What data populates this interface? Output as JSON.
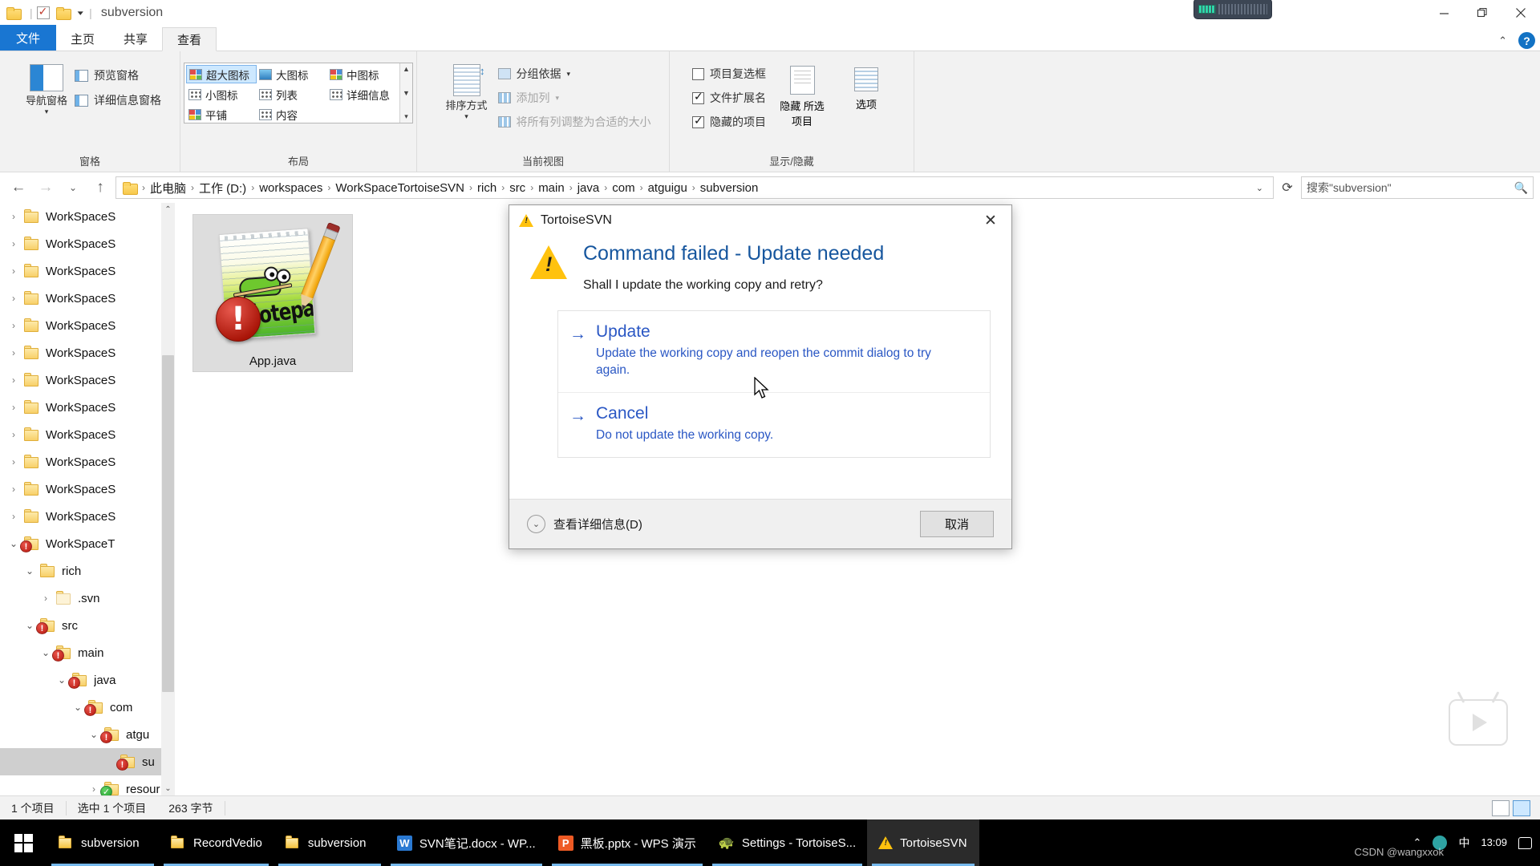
{
  "window": {
    "title": "subversion",
    "quick_access": {
      "folder_icon": "folder-icon",
      "properties_icon": "properties-checkbox-icon",
      "new_folder_icon": "new-folder-icon",
      "dropdown_icon": "chevron-down-icon"
    },
    "controls": {
      "minimize": "minimize-icon",
      "maximize": "maximize-icon",
      "close": "close-icon",
      "collapse_ribbon": "chevron-up-icon",
      "help": "?"
    }
  },
  "tabs": [
    {
      "label": "文件",
      "state": "file-menu"
    },
    {
      "label": "主页",
      "state": "normal"
    },
    {
      "label": "共享",
      "state": "normal"
    },
    {
      "label": "查看",
      "state": "active"
    }
  ],
  "ribbon": {
    "groups": [
      {
        "name": "窗格",
        "big_button": {
          "label": "导航窗格",
          "icon": "navigation-pane-icon",
          "has_dropdown": true
        },
        "items": [
          {
            "label": "预览窗格",
            "icon": "preview-pane-icon",
            "disabled": false
          },
          {
            "label": "详细信息窗格",
            "icon": "details-pane-icon",
            "disabled": false
          }
        ]
      },
      {
        "name": "布局",
        "views": [
          {
            "label": "超大图标",
            "selected": true
          },
          {
            "label": "大图标",
            "selected": false
          },
          {
            "label": "中图标",
            "selected": false
          },
          {
            "label": "小图标",
            "selected": false
          },
          {
            "label": "列表",
            "selected": false
          },
          {
            "label": "详细信息",
            "selected": false
          },
          {
            "label": "平铺",
            "selected": false
          },
          {
            "label": "内容",
            "selected": false
          }
        ]
      },
      {
        "name": "当前视图",
        "big_button": {
          "label": "排序方式",
          "icon": "sort-icon",
          "has_dropdown": true
        },
        "items": [
          {
            "label": "分组依据",
            "icon": "group-by-icon",
            "disabled": false,
            "has_dropdown": true
          },
          {
            "label": "添加列",
            "icon": "add-column-icon",
            "disabled": true,
            "has_dropdown": true
          },
          {
            "label": "将所有列调整为合适的大小",
            "icon": "fit-columns-icon",
            "disabled": true
          }
        ]
      },
      {
        "name": "显示/隐藏",
        "checkboxes": [
          {
            "label": "项目复选框",
            "checked": false
          },
          {
            "label": "文件扩展名",
            "checked": true
          },
          {
            "label": "隐藏的项目",
            "checked": true
          }
        ],
        "buttons": [
          {
            "label": "隐藏 所选项目",
            "icon": "hide-selected-icon"
          },
          {
            "label": "选项",
            "icon": "options-icon"
          }
        ]
      }
    ]
  },
  "address_bar": {
    "back_icon": "back-arrow-icon",
    "forward_icon": "forward-arrow-icon",
    "recent_icon": "chevron-down-icon",
    "up_icon": "up-arrow-icon",
    "folder_icon": "folder-icon",
    "breadcrumbs": [
      "此电脑",
      "工作 (D:)",
      "workspaces",
      "WorkSpaceTortoiseSVN",
      "rich",
      "src",
      "main",
      "java",
      "com",
      "atguigu",
      "subversion"
    ],
    "dropdown_icon": "chevron-down-icon",
    "refresh_icon": "refresh-icon",
    "search_placeholder": "搜索\"subversion\"",
    "search_icon": "search-icon"
  },
  "tree": {
    "items": [
      {
        "label": "WorkSpaceS",
        "indent": 1,
        "expanded": false,
        "overlay": "none",
        "selected": false
      },
      {
        "label": "WorkSpaceS",
        "indent": 1,
        "expanded": false,
        "overlay": "none",
        "selected": false
      },
      {
        "label": "WorkSpaceS",
        "indent": 1,
        "expanded": false,
        "overlay": "none",
        "selected": false
      },
      {
        "label": "WorkSpaceS",
        "indent": 1,
        "expanded": false,
        "overlay": "none",
        "selected": false
      },
      {
        "label": "WorkSpaceS",
        "indent": 1,
        "expanded": false,
        "overlay": "none",
        "selected": false
      },
      {
        "label": "WorkSpaceS",
        "indent": 1,
        "expanded": false,
        "overlay": "none",
        "selected": false
      },
      {
        "label": "WorkSpaceS",
        "indent": 1,
        "expanded": false,
        "overlay": "none",
        "selected": false
      },
      {
        "label": "WorkSpaceS",
        "indent": 1,
        "expanded": false,
        "overlay": "none",
        "selected": false
      },
      {
        "label": "WorkSpaceS",
        "indent": 1,
        "expanded": false,
        "overlay": "none",
        "selected": false
      },
      {
        "label": "WorkSpaceS",
        "indent": 1,
        "expanded": false,
        "overlay": "none",
        "selected": false
      },
      {
        "label": "WorkSpaceS",
        "indent": 1,
        "expanded": false,
        "overlay": "none",
        "selected": false
      },
      {
        "label": "WorkSpaceS",
        "indent": 1,
        "expanded": false,
        "overlay": "none",
        "selected": false
      },
      {
        "label": "WorkSpaceT",
        "indent": 1,
        "expanded": true,
        "overlay": "modified",
        "selected": false
      },
      {
        "label": "rich",
        "indent": 2,
        "expanded": true,
        "overlay": "none",
        "selected": false
      },
      {
        "label": ".svn",
        "indent": 3,
        "expanded": false,
        "overlay": "none",
        "ghost": true,
        "selected": false
      },
      {
        "label": "src",
        "indent": 2,
        "expanded": true,
        "overlay": "modified",
        "selected": false
      },
      {
        "label": "main",
        "indent": 3,
        "expanded": true,
        "overlay": "modified",
        "selected": false
      },
      {
        "label": "java",
        "indent": 4,
        "expanded": true,
        "overlay": "modified",
        "selected": false
      },
      {
        "label": "com",
        "indent": 5,
        "expanded": true,
        "overlay": "modified",
        "selected": false
      },
      {
        "label": "atgu",
        "indent": 6,
        "expanded": true,
        "overlay": "modified",
        "selected": false
      },
      {
        "label": "su",
        "indent": 7,
        "expanded": false,
        "overlay": "modified",
        "selected": true
      },
      {
        "label": "resour",
        "indent": 6,
        "expanded": false,
        "overlay": "ok",
        "selected": false
      }
    ],
    "scroll_up_icon": "chevron-up-icon",
    "scroll_down_icon": "chevron-down-icon"
  },
  "file_pane": {
    "items": [
      {
        "name": "App.java",
        "icon": "notepadpp-file-icon",
        "overlay": "modified",
        "selected": true,
        "icon_text": "Notepad++"
      }
    ]
  },
  "status_bar": {
    "item_count": "1 个项目",
    "selection": "选中 1 个项目",
    "size": "263 字节",
    "view_detail_icon": "details-view-icon",
    "view_large_icon": "large-icons-view-icon"
  },
  "dialog": {
    "app_name": "TortoiseSVN",
    "warning_icon": "warning-triangle-icon",
    "close_icon": "close-icon",
    "heading": "Command failed - Update needed",
    "question": "Shall I update the working copy and retry?",
    "commands": [
      {
        "title": "Update",
        "description": "Update the working copy and reopen the commit dialog to try again.",
        "arrow_icon": "arrow-right-icon"
      },
      {
        "title": "Cancel",
        "description": "Do not update the working copy.",
        "arrow_icon": "arrow-right-icon"
      }
    ],
    "expander_label": "查看详细信息(D)",
    "expander_icon": "chevron-down-circle-icon",
    "cancel_button": "取消",
    "accent_color": "#2a57c4",
    "heading_color": "#16569e"
  },
  "taskbar": {
    "start_icon": "windows-logo-icon",
    "items": [
      {
        "label": "subversion",
        "icon": "folder-icon",
        "active": false
      },
      {
        "label": "RecordVedio",
        "icon": "folder-icon",
        "active": false
      },
      {
        "label": "subversion",
        "icon": "folder-icon",
        "active": false
      },
      {
        "label": "SVN笔记.docx - WP...",
        "icon": "wps-writer-icon",
        "active": false
      },
      {
        "label": "黑板.pptx - WPS 演示",
        "icon": "wps-presentation-icon",
        "active": false
      },
      {
        "label": "Settings - TortoiseS...",
        "icon": "tortoisesvn-icon",
        "active": false
      },
      {
        "label": "TortoiseSVN",
        "icon": "warning-triangle-icon",
        "active": true
      }
    ],
    "tray": {
      "chevron_icon": "chevron-up-icon",
      "network_icon": "network-icon",
      "ime_label": "中",
      "time": "13:09",
      "notification_icon": "notification-icon"
    },
    "watermark": "CSDN @wangxxok"
  },
  "overlays": {
    "recorder_widget": "screen-recorder-toolbar",
    "video_watermark": "video-play-watermark"
  }
}
